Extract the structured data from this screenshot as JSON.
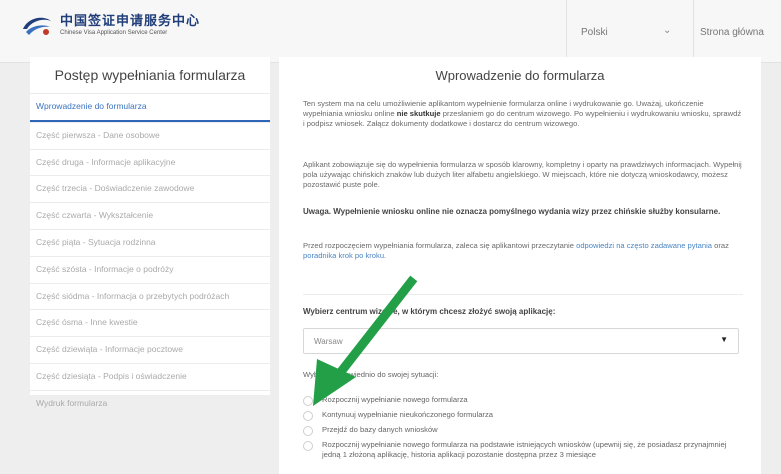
{
  "header": {
    "logo_cn": "中国签证申请服务中心",
    "logo_en": "Chinese Visa Application Service Center",
    "language_value": "Polski",
    "home_label": "Strona główna"
  },
  "sidebar": {
    "title": "Postęp wypełniania formularza",
    "items": [
      {
        "label": "Wprowadzenie do formularza"
      },
      {
        "label": "Część pierwsza - Dane osobowe"
      },
      {
        "label": "Część druga - Informacje aplikacyjne"
      },
      {
        "label": "Część trzecia - Doświadczenie zawodowe"
      },
      {
        "label": "Część czwarta - Wykształcenie"
      },
      {
        "label": "Część piąta - Sytuacja rodzinna"
      },
      {
        "label": "Część szósta - Informacje o podróży"
      },
      {
        "label": "Część siódma - Informacja o przebytych podróżach"
      },
      {
        "label": "Część ósma - Inne kwestie"
      },
      {
        "label": "Część dziewiąta - Informacje pocztowe"
      },
      {
        "label": "Część dziesiąta - Podpis i oświadczenie"
      },
      {
        "label": "Wydruk formularza"
      }
    ]
  },
  "main": {
    "title": "Wprowadzenie do formularza",
    "p1_a": "Ten system ma na celu umożliwienie aplikantom wypełnienie formularza online i wydrukowanie go. Uważaj, ukończenie wypełniania wniosku online ",
    "p1_bold": "nie skutkuje",
    "p1_b": " przesłaniem go do centrum wizowego. Po wypełnieniu i wydrukowaniu wniosku, sprawdź i podpisz wniosek. Załącz dokumenty dodatkowe i dostarcz do centrum wizowego.",
    "p2": "Aplikant zobowiązuje się do wypełnienia formularza w sposób klarowny, kompletny i oparty na prawdziwych informacjach. Wypełnij pola używając chińskich znaków lub dużych liter alfabetu angielskiego. W miejscach, które nie dotyczą wnioskodawcy, możesz pozostawić puste pole.",
    "warning": "Uwaga. Wypełnienie wniosku online nie oznacza pomyślnego wydania wizy przez chińskie służby konsularne.",
    "p4_a": "Przed rozpoczęciem wypełniania formularza, zaleca się aplikantowi przeczytanie ",
    "p4_link1": "odpowiedzi na często zadawane pytania",
    "p4_mid": " oraz ",
    "p4_link2": "poradnika krok po kroku",
    "p4_end": ".",
    "center_label": "Wybierz centrum wizowe, w którym chcesz złożyć swoją aplikację:",
    "center_value": "Warsaw",
    "situation_label": "Wybierz odpowiednio do swojej sytuacji:",
    "options": [
      {
        "label": "Rozpocznij wypełnianie nowego formularza"
      },
      {
        "label": "Kontynuuj wypełnianie nieukończonego formularza"
      },
      {
        "label": "Przejdź do bazy danych wniosków"
      },
      {
        "label": "Rozpocznij wypełnianie nowego formularza na podstawie istniejących wniosków (upewnij się, że posiadasz przynajmniej jedną 1 złożoną aplikację, historia aplikacji pozostanie dostępna przez 3 miesiące"
      }
    ]
  },
  "colors": {
    "accent": "#2f66b8",
    "arrow": "#23a047",
    "link": "#4a86c5"
  },
  "icons": {
    "logo": "cvasc-logo-icon",
    "dropdown": "chevron-down-icon",
    "select_caret": "caret-down-icon",
    "annotation": "green-arrow-icon"
  }
}
